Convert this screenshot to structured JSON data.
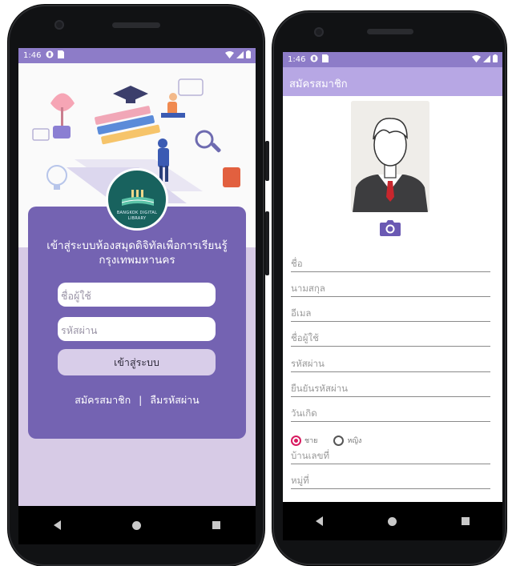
{
  "status_bar": {
    "time": "1:46"
  },
  "login": {
    "logo_line1": "BANGKOK DIGITAL",
    "logo_line2": "LIBRARY",
    "title_line1": "เข้าสู่ระบบห้องสมุดดิจิทัลเพื่อการเรียนรู้",
    "title_line2": "กรุงเทพมหานคร",
    "username_placeholder": "ชื่อผู้ใช้",
    "password_placeholder": "รหัสผ่าน",
    "login_button": "เข้าสู่ระบบ",
    "register_link": "สมัครสมาชิก",
    "separator": "|",
    "forgot_link": "ลืมรหัสผ่าน"
  },
  "register": {
    "title": "สมัครสมาชิก",
    "fields": {
      "first_name": "ชื่อ",
      "last_name": "นามสกุล",
      "email": "อีเมล",
      "username": "ชื่อผู้ใช้",
      "password": "รหัสผ่าน",
      "confirm_password": "ยืนยันรหัสผ่าน",
      "birthdate": "วันเกิด",
      "house_no": "บ้านเลขที่",
      "moo": "หมู่ที่"
    },
    "gender_male": "ชาย",
    "gender_female": "หญิง",
    "selected_gender": "ชาย"
  },
  "colors": {
    "status_bar": "#8d7cc8",
    "card": "#7463b2",
    "app_bar": "#b7a7e4",
    "accent": "#d81b60"
  }
}
